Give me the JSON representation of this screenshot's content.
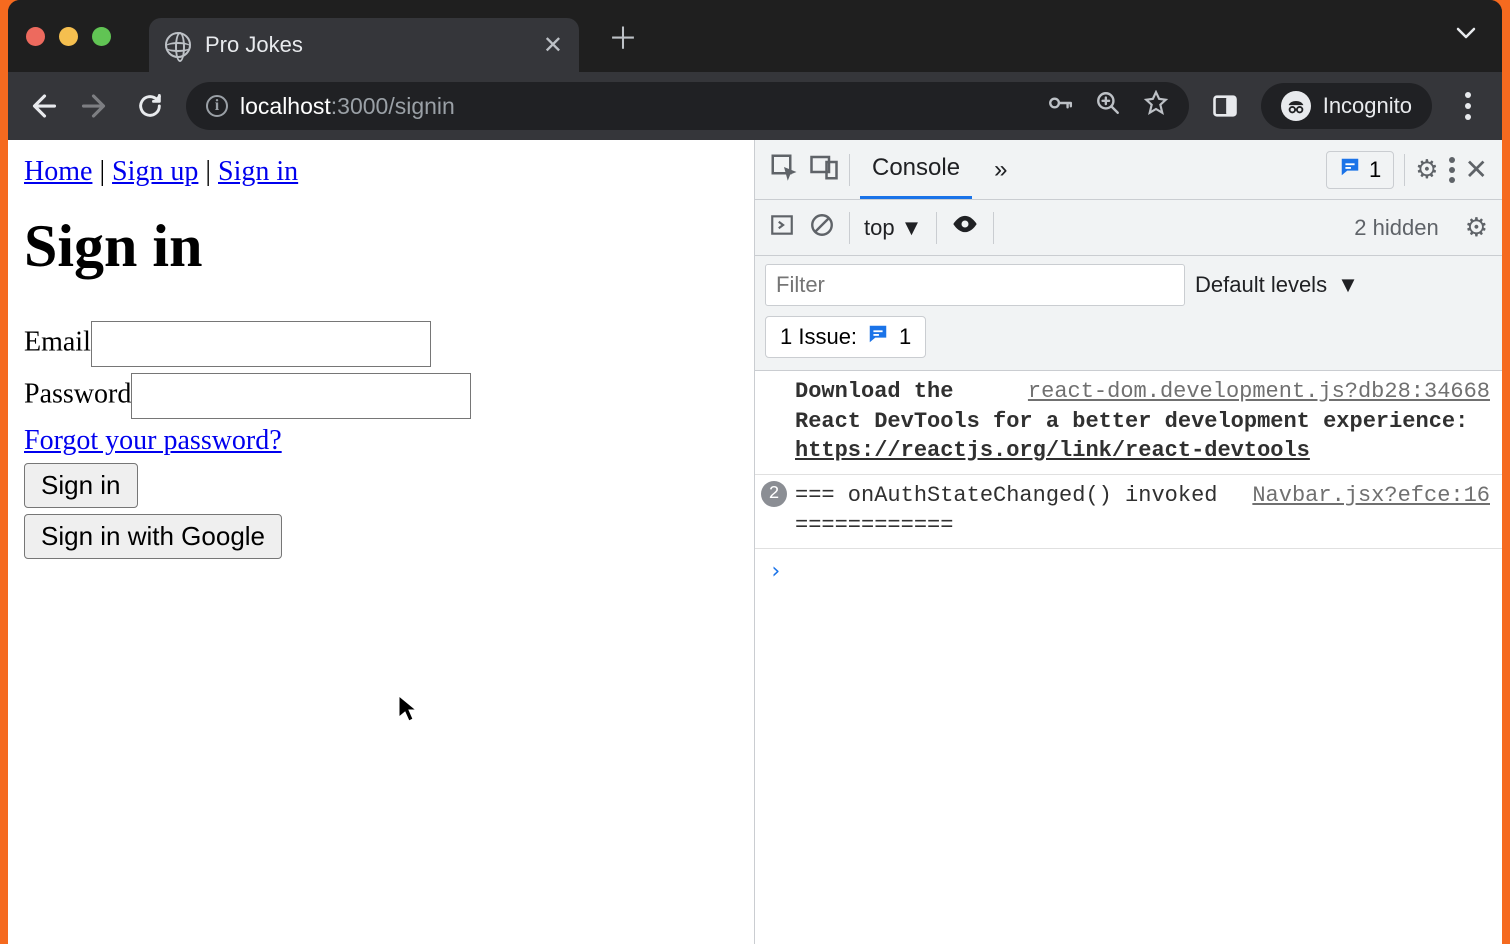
{
  "browser": {
    "tab_title": "Pro Jokes",
    "url_host": "localhost",
    "url_port_path": ":3000/signin",
    "incognito_label": "Incognito",
    "tabs_dropdown_caret": "▾",
    "nav_back": "←",
    "nav_forward": "→"
  },
  "page": {
    "nav": {
      "home": "Home",
      "signup": "Sign up",
      "signin": "Sign in",
      "sep": " | "
    },
    "heading": "Sign in",
    "form": {
      "email_label": "Email",
      "password_label": "Password",
      "forgot_link": "Forgot your password?",
      "signin_btn": "Sign in",
      "google_btn": "Sign in with Google"
    }
  },
  "devtools": {
    "tabs": {
      "console": "Console",
      "more": "»"
    },
    "issues_count": "1",
    "toolbar": {
      "context": "top",
      "hidden": "2 hidden"
    },
    "filter_placeholder": "Filter",
    "levels_label": "Default levels",
    "issues_label": "1 Issue:",
    "issues_badge_count": "1",
    "messages": [
      {
        "src": "react-dom.development.js?db28:34668",
        "body_bold": "Download the React DevTools for a better development experience: ",
        "link": "https://reactjs.org/link/react-devtools"
      },
      {
        "count": "2",
        "src": "Navbar.jsx?efce:16",
        "body": "=== onAuthStateChanged() invoked ============"
      }
    ],
    "prompt": "›"
  }
}
